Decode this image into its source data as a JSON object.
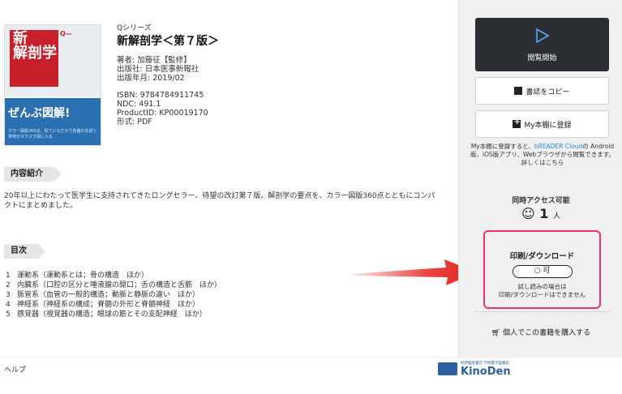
{
  "book": {
    "series": "Qシリーズ",
    "title": "新解剖学＜第７版＞",
    "author": "著者: 加藤征【監修】",
    "publisher": "出版社: 日本医事新報社",
    "pub_date": "出版年月: 2019/02",
    "isbn": "ISBN: 9784784911745",
    "ndc": "NDC: 491.1",
    "product_id": "ProductID: KP00019170",
    "format": "形式: PDF"
  },
  "cover": {
    "title_line1": "新",
    "title_line2": "解剖学",
    "badge": "Q—",
    "catch": "ぜんぶ図解!",
    "catch_sub": "カラー図版360点、見ているだけで各器の名前と意味がスラスラ頭に入る"
  },
  "intro": {
    "label": "内容紹介",
    "text": "20年以上にわたって医学生に支持されてきたロングセラー、待望の改訂第７版。解剖学の要点を、カラー図版360点とともにコンパクトにまとめました。"
  },
  "toc": {
    "label": "目次",
    "items": [
      {
        "num": "1",
        "text": "運動系（運動系とは；骨の構造　ほか）"
      },
      {
        "num": "2",
        "text": "内臓系（口腔の区分と唾液腺の開口；舌の構造と舌筋　ほか）"
      },
      {
        "num": "3",
        "text": "脈管系（血管の一般的構造；動脈と静脈の違い　ほか）"
      },
      {
        "num": "4",
        "text": "神経系（神経系の構成；脊髄の外形と脊髄神経　ほか）"
      },
      {
        "num": "5",
        "text": "感覚器（視覚器の構造；眼球の筋とその支配神経　ほか）"
      }
    ]
  },
  "sidebar": {
    "start_label": "閲覧開始",
    "copy_label": "書誌をコピー",
    "shelf_label": "My本棚に登録",
    "note_pre": "My本棚に登録すると、",
    "note_brand": "bREADER Cloud",
    "note_post": "の Android版、iOS版アプリ、Webブラウザから閲覧できます。詳しくはこちら",
    "access_head": "同時アクセス可能",
    "access_count": "1",
    "access_unit": "人",
    "pd_title": "印刷/ダウンロード",
    "pd_status": "○ 可",
    "pd_note_1": "試し読みの場合は",
    "pd_note_2": "印刷/ダウンロードはできません",
    "buy_label": "個人でこの書籍を購入する"
  },
  "footer": {
    "help": "ヘルプ",
    "logo_small": "紀伊國屋書店 学術電子図書館",
    "logo_word": "KinoDen"
  },
  "colors": {
    "highlight_border": "#e8336d",
    "arrow": "#e52420",
    "start_button": "#2b2e33"
  }
}
